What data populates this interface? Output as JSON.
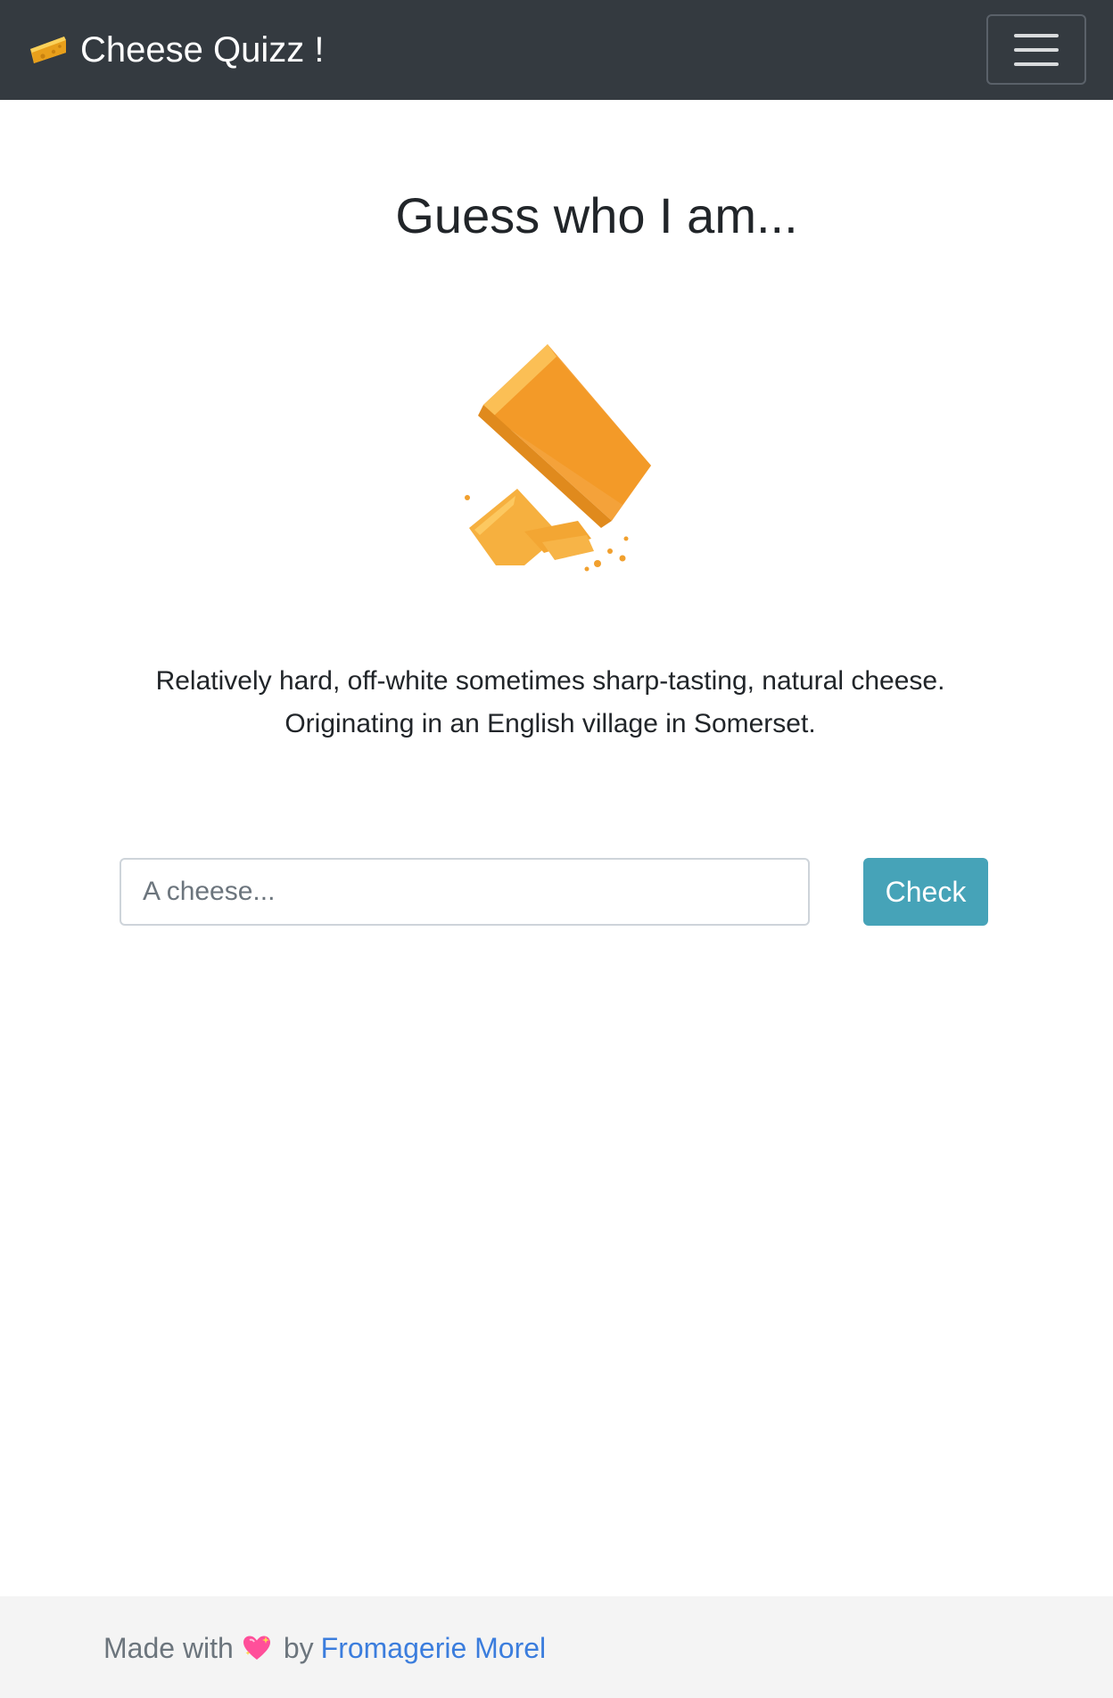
{
  "navbar": {
    "brand_label": "Cheese Quizz !",
    "brand_icon": "cheese-wedge-icon",
    "menu_icon": "hamburger-menu-icon"
  },
  "main": {
    "heading": "Guess who I am...",
    "description_line1": "Relatively hard, off-white sometimes sharp-tasting, natural cheese.",
    "description_line2": "Originating in an English village in Somerset.",
    "guess_input": {
      "value": "",
      "placeholder": "A cheese..."
    },
    "check_label": "Check"
  },
  "footer": {
    "made_with": "Made with",
    "by": "by",
    "author_link": "Fromagerie Morel",
    "heart_icon": "sparkling-heart-icon"
  },
  "colors": {
    "navbar_bg": "#343a40",
    "check_button": "#46a3b8",
    "link": "#3b7ddd",
    "footer_bg": "#f4f4f4"
  }
}
